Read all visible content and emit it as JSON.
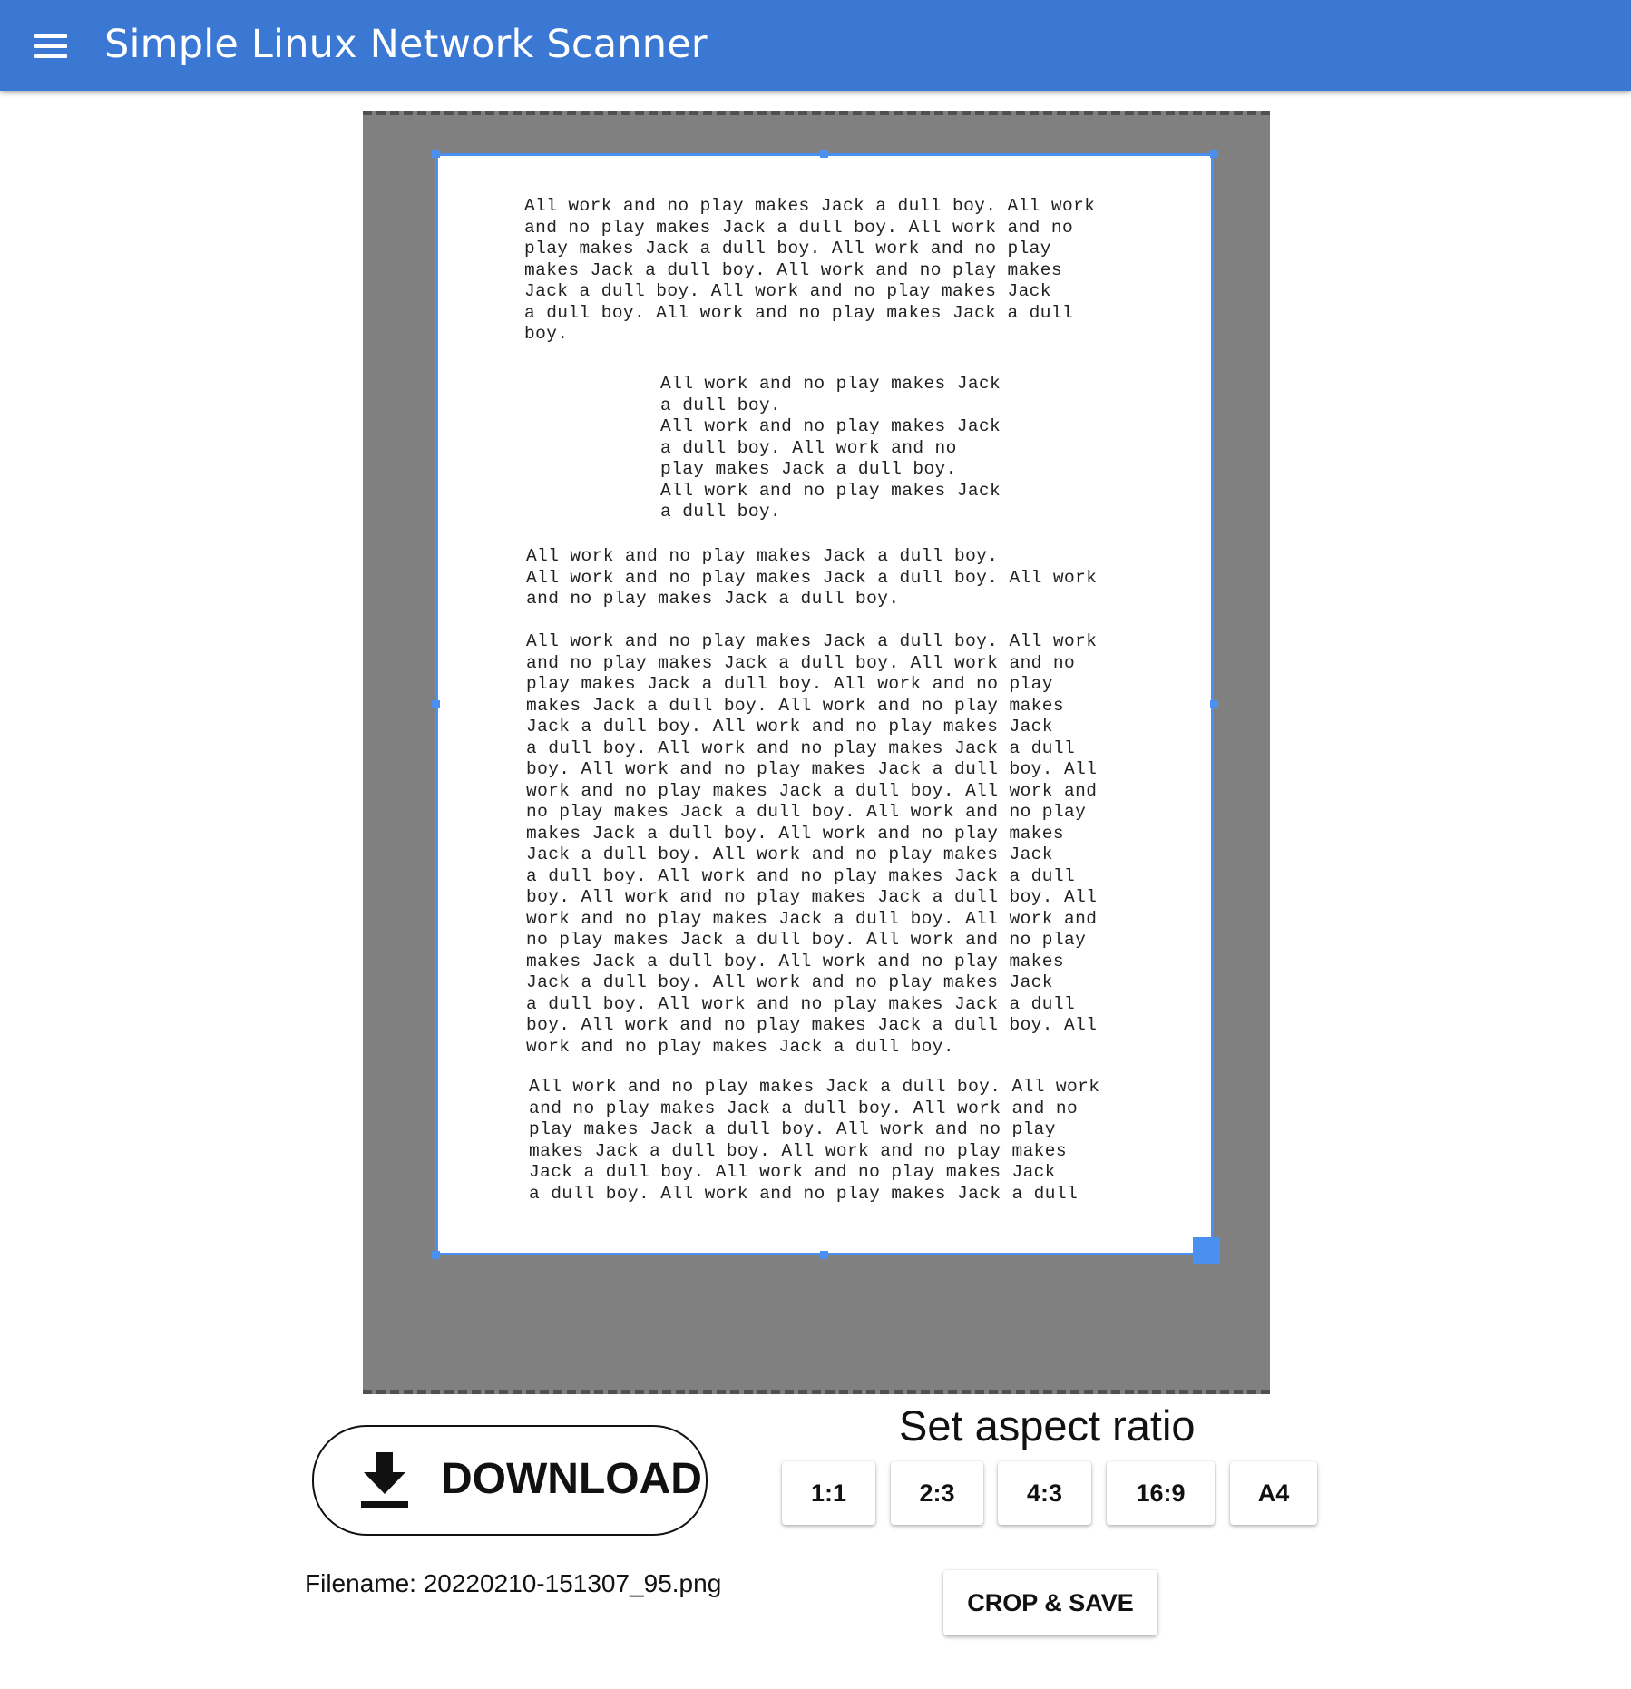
{
  "appbar": {
    "title": "Simple Linux Network Scanner",
    "menu_icon": "hamburger-menu-icon",
    "color": "#3a78d4"
  },
  "document": {
    "paragraphs": [
      "All work and no play makes Jack a dull boy. All work\nand no play makes Jack a dull boy. All work and no\nplay makes Jack a dull boy. All work and no play\nmakes Jack a dull boy. All work and no play makes\nJack a dull boy. All work and no play makes Jack\na dull boy. All work and no play makes Jack a dull\nboy.",
      "All work and no play makes Jack\na dull boy.\nAll work and no play makes Jack\na dull boy. All work and no\nplay makes Jack a dull boy.\nAll work and no play makes Jack\na dull boy.",
      "All work and no play makes Jack a dull boy.\nAll work and no play makes Jack a dull boy. All work\nand no play makes Jack a dull boy.",
      "All work and no play makes Jack a dull boy. All work\nand no play makes Jack a dull boy. All work and no\nplay makes Jack a dull boy. All work and no play\nmakes Jack a dull boy. All work and no play makes\nJack a dull boy. All work and no play makes Jack\na dull boy. All work and no play makes Jack a dull\nboy. All work and no play makes Jack a dull boy. All\nwork and no play makes Jack a dull boy. All work and\nno play makes Jack a dull boy. All work and no play\nmakes Jack a dull boy. All work and no play makes\nJack a dull boy. All work and no play makes Jack\na dull boy. All work and no play makes Jack a dull\nboy. All work and no play makes Jack a dull boy. All\nwork and no play makes Jack a dull boy. All work and\nno play makes Jack a dull boy. All work and no play\nmakes Jack a dull boy. All work and no play makes\nJack a dull boy. All work and no play makes Jack\na dull boy. All work and no play makes Jack a dull\nboy. All work and no play makes Jack a dull boy. All\nwork and no play makes Jack a dull boy.",
      "All work and no play makes Jack a dull boy. All work\nand no play makes Jack a dull boy. All work and no\nplay makes Jack a dull boy. All work and no play\nmakes Jack a dull boy. All work and no play makes\nJack a dull boy. All work and no play makes Jack\na dull boy. All work and no play makes Jack a dull"
    ]
  },
  "crop": {
    "frame_color": "#4b8ff0"
  },
  "download": {
    "label": "DOWNLOAD",
    "icon": "download-icon"
  },
  "file": {
    "filename_text": "Filename: 20220210-151307_95.png"
  },
  "aspect": {
    "heading": "Set aspect ratio",
    "options": [
      "1:1",
      "2:3",
      "4:3",
      "16:9",
      "A4"
    ]
  },
  "actions": {
    "crop_save_label": "CROP & SAVE"
  }
}
